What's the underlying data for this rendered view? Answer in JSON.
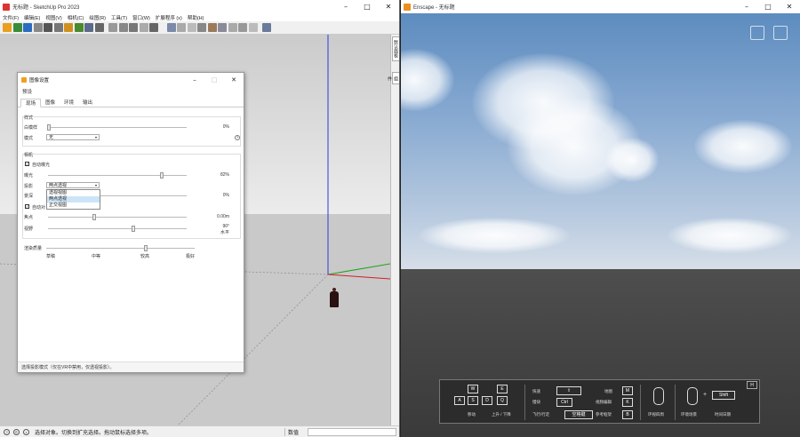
{
  "sketchup": {
    "title": "无标题 - SketchUp Pro 2023",
    "menu": [
      "文件(F)",
      "编辑(E)",
      "视图(V)",
      "相机(C)",
      "绘图(R)",
      "工具(T)",
      "窗口(W)",
      "扩展程序 (x)",
      "帮助(H)"
    ],
    "side_tabs": [
      "默认面板",
      "组件"
    ],
    "status": {
      "message": "选择对象。切换到扩充选择。拖动鼠标选择多项。",
      "measure_label": "数值",
      "measure_value": ""
    }
  },
  "dialog": {
    "title": "图像设置",
    "preset_label": "预设",
    "tabs": [
      "现场",
      "图像",
      "环境",
      "输出"
    ],
    "active_tab": 0,
    "style_group": "样式",
    "contrast_label": "白模样",
    "contrast_value": "0%",
    "mode_label": "模式",
    "mode_value": "无",
    "camera_group": "相机",
    "auto_exposure_label": "自动曝光",
    "auto_exposure_checked": true,
    "exposure_label": "曝光",
    "exposure_value": "82%",
    "projection_label": "投影",
    "projection_value": "两点透视",
    "projection_options": [
      "透视视图",
      "两点透视",
      "正交视图"
    ],
    "projection_highlight": 1,
    "depth_label": "景深",
    "depth_value": "0%",
    "auto_focus_label": "自动对",
    "focus_label": "焦点",
    "focus_value": "0.00m",
    "fov_label": "视野",
    "fov_value": "90°",
    "fov_sub": "水平",
    "quality_label": "渲染质量",
    "quality_ticks": [
      "草稿",
      "中等",
      "较高",
      "极好"
    ],
    "hint": "选择投影模式（仅在VR中禁用，仅透视投影）。"
  },
  "enscape": {
    "title": "Enscape - 无标题",
    "keys": {
      "wasd": [
        "W",
        "E",
        "A",
        "S",
        "D",
        "Q"
      ],
      "move_label": "移动",
      "updown_label": "上升 / 下降",
      "fast_label": "快速",
      "fast_key": "⇧",
      "slow_label": "慢快",
      "slow_key": "Ctrl",
      "fly_label": "飞行/行走",
      "space_key": "空格键",
      "map_label": "地图",
      "map_key": "M",
      "video_label": "视频编辑",
      "video_key": "K",
      "bookmark_label": "参考框架",
      "bookmark_key": "B",
      "look_label": "环视四周",
      "env_label": "环境场景",
      "time_label": "时间日期",
      "shift_key": "Shift",
      "help_key": "H"
    }
  },
  "colors": {
    "axis_blue": "#2a3bd8",
    "axis_green": "#1ea21e",
    "axis_red": "#d02020",
    "dialog_icon": "#f0a020"
  }
}
